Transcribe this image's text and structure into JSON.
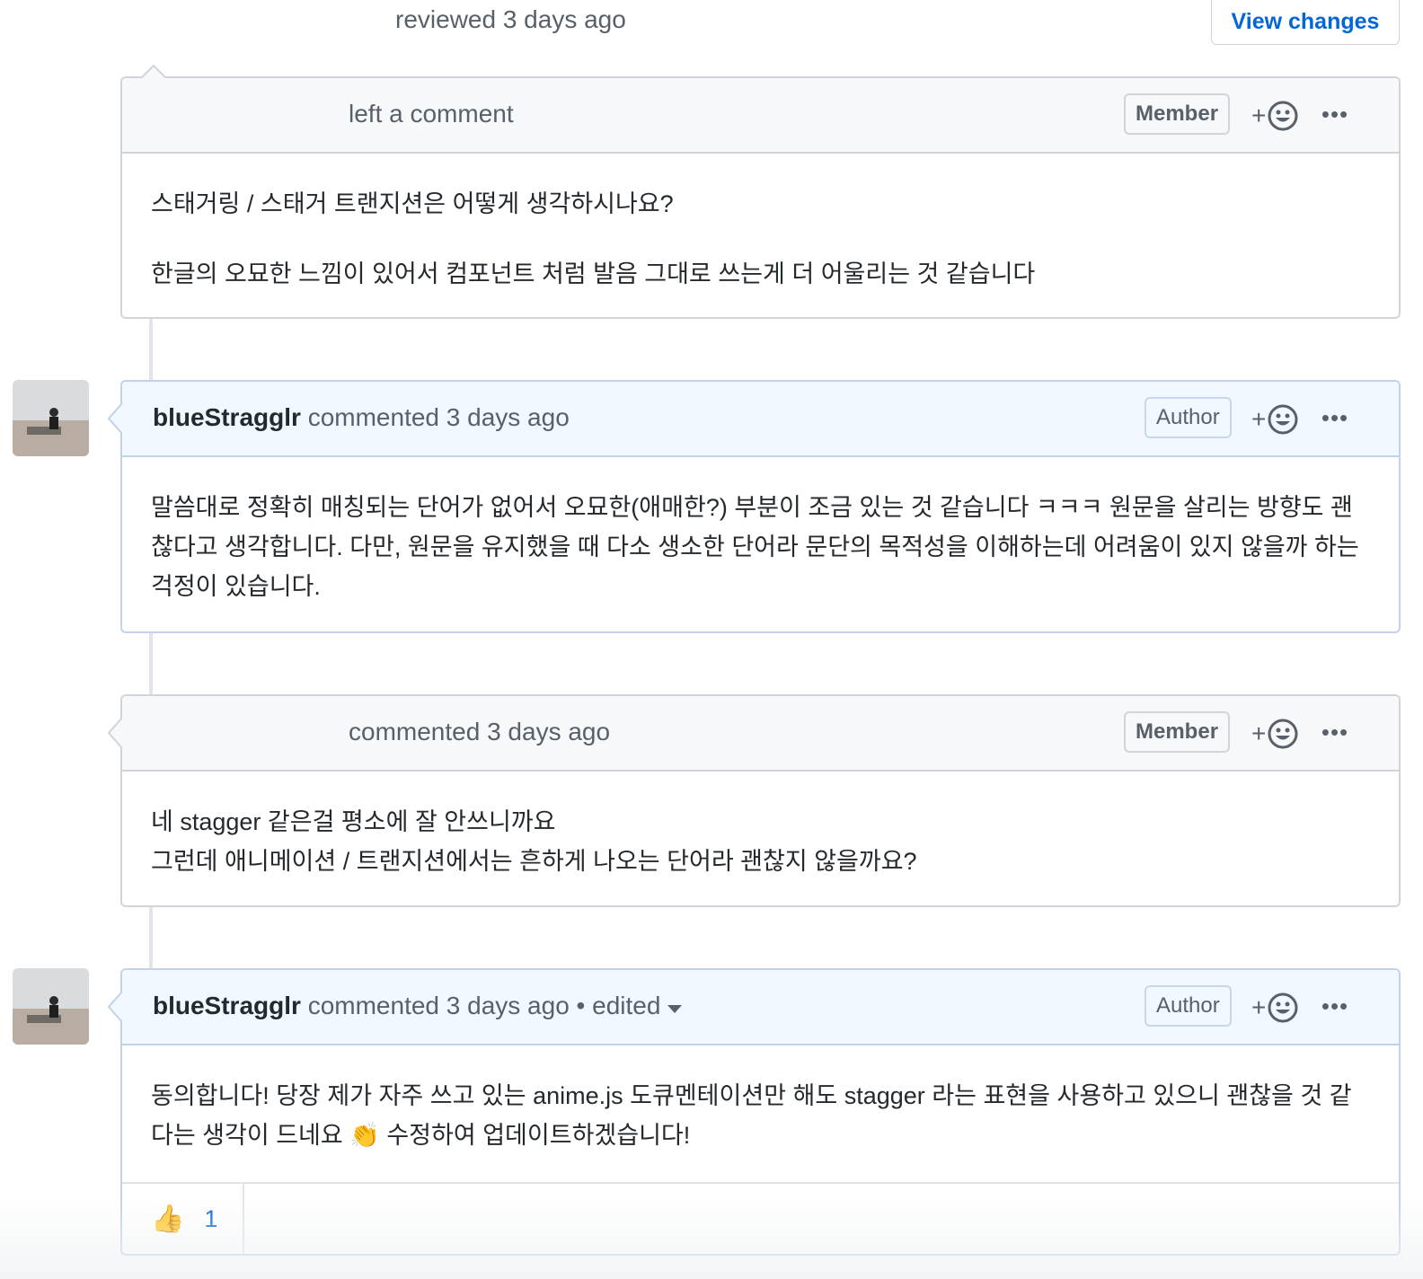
{
  "review": {
    "text": "reviewed 3 days ago",
    "view_changes_label": "View changes"
  },
  "comments": [
    {
      "meta": "left a comment",
      "badge": "Member",
      "react_plus": "+",
      "more": "•••",
      "body": [
        "스태거링 / 스태거 트랜지션은 어떻게 생각하시나요?",
        "한글의 오묘한 느낌이 있어서 컴포넌트 처럼 발음 그대로 쓰는게 더 어울리는 것 같습니다"
      ]
    },
    {
      "author": "blueStragglr",
      "meta": "commented 3 days ago",
      "badge": "Author",
      "react_plus": "+",
      "more": "•••",
      "body": [
        "말씀대로 정확히 매칭되는 단어가 없어서 오묘한(애매한?) 부분이 조금 있는 것 같습니다 ㅋㅋㅋ 원문을 살리는 방향도 괜찮다고 생각합니다. 다만, 원문을 유지했을 때 다소 생소한 단어라 문단의 목적성을 이해하는데 어려움이 있지 않을까 하는 걱정이 있습니다."
      ]
    },
    {
      "meta": "commented 3 days ago",
      "badge": "Member",
      "react_plus": "+",
      "more": "•••",
      "body": [
        "네 stagger 같은걸 평소에 잘 안쓰니까요",
        "그런데 애니메이션 / 트랜지션에서는 흔하게 나오는 단어라 괜찮지 않을까요?"
      ]
    },
    {
      "author": "blueStragglr",
      "meta": "commented 3 days ago",
      "edited": "• edited",
      "badge": "Author",
      "react_plus": "+",
      "more": "•••",
      "body": [
        "동의합니다! 당장 제가 자주 쓰고 있는 anime.js 도큐멘테이션만 해도 stagger 라는 표현을 사용하고 있으니 괜찮을 것 같다는 생각이 드네요 👏 수정하여 업데이트하겠습니다!"
      ],
      "reaction": {
        "emoji": "👍",
        "count": "1"
      }
    }
  ],
  "colors": {
    "link": "#0366d6",
    "author_header": "#f1f8ff",
    "default_header": "#f6f8fa"
  }
}
